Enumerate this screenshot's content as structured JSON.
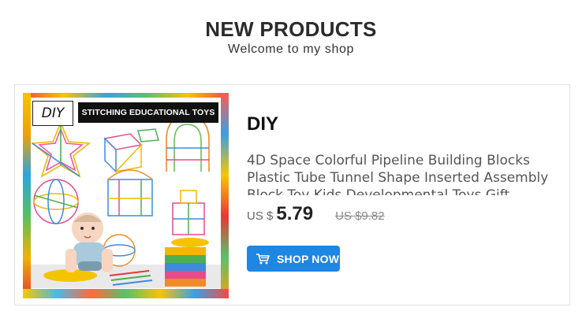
{
  "header": {
    "title": "NEW PRODUCTS",
    "subtitle": "Welcome to my shop"
  },
  "product": {
    "image": {
      "diy_tag": "DIY",
      "banner_text": "STITCHING  EDUCATIONAL TOYS"
    },
    "brand": "DIY",
    "description": "4D Space Colorful Pipeline Building Blocks Plastic Tube Tunnel Shape Inserted Assembly Block Toy Kids Developmental Toys Gift",
    "price_currency": "US $",
    "price_value": "5.79",
    "old_price": "US $9.82",
    "button_label": "SHOP NOW",
    "button_icon": "cart-icon",
    "accent_color": "#1e86e3"
  }
}
